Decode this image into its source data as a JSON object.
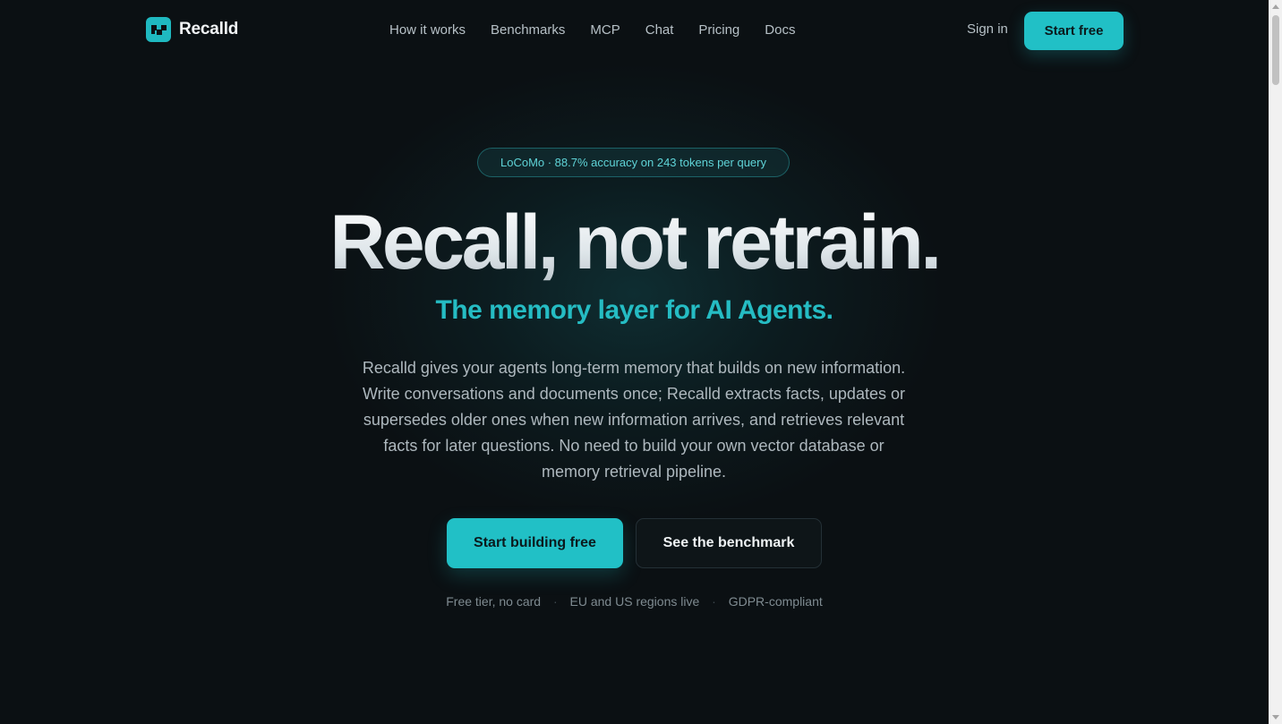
{
  "brand": {
    "name": "Recalld",
    "logo_icon": "recalld-logo-icon",
    "accent_color": "#21c0c6"
  },
  "nav": {
    "links": [
      "How it works",
      "Benchmarks",
      "MCP",
      "Chat",
      "Pricing",
      "Docs"
    ],
    "sign_in": "Sign in",
    "start_free": "Start free"
  },
  "hero": {
    "badge": "LoCoMo · 88.7% accuracy on 243 tokens per query",
    "headline": "Recall, not retrain.",
    "subheadline": "The memory layer for AI Agents.",
    "description": "Recalld gives your agents long-term memory that builds on new information. Write conversations and documents once; Recalld extracts facts, updates or supersedes older ones when new information arrives, and retrieves relevant facts for later questions. No need to build your own vector database or memory retrieval pipeline.",
    "primary_cta": "Start building free",
    "secondary_cta": "See the benchmark",
    "assurances": [
      "Free tier, no card",
      "EU and US regions live",
      "GDPR-compliant"
    ]
  },
  "assurance_separator": "·"
}
